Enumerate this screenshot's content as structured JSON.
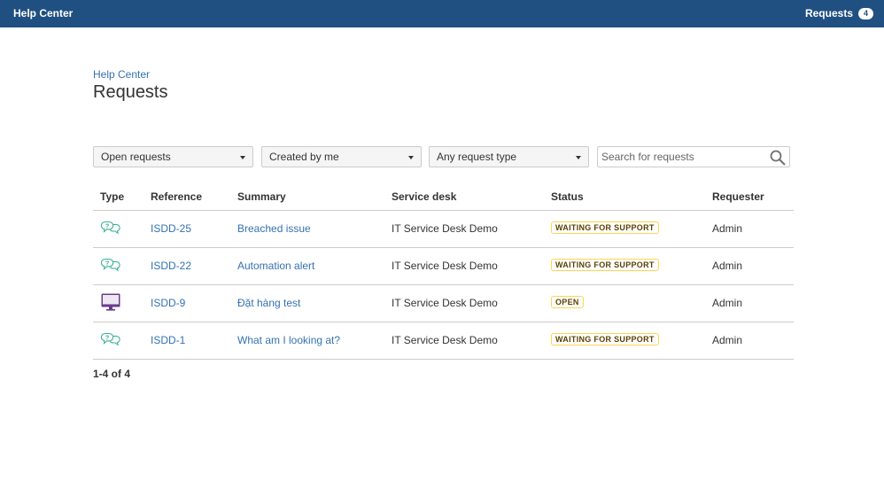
{
  "topbar": {
    "brand": "Help Center",
    "requests_label": "Requests",
    "requests_count": "4",
    "background": "#205081"
  },
  "breadcrumb": "Help Center",
  "page_title": "Requests",
  "filters": {
    "status": "Open requests",
    "creator": "Created by me",
    "request_type": "Any request type",
    "search_placeholder": "Search for requests"
  },
  "table": {
    "columns": [
      "Type",
      "Reference",
      "Summary",
      "Service desk",
      "Status",
      "Requester"
    ],
    "rows": [
      {
        "type_icon": "question-bubble-icon",
        "reference": "ISDD-25",
        "summary": "Breached issue",
        "service_desk": "IT Service Desk Demo",
        "status": "WAITING FOR SUPPORT",
        "requester": "Admin"
      },
      {
        "type_icon": "question-bubble-icon",
        "reference": "ISDD-22",
        "summary": "Automation alert",
        "service_desk": "IT Service Desk Demo",
        "status": "WAITING FOR SUPPORT",
        "requester": "Admin"
      },
      {
        "type_icon": "computer-monitor-icon",
        "reference": "ISDD-9",
        "summary": "Đặt hàng test",
        "service_desk": "IT Service Desk Demo",
        "status": "OPEN",
        "requester": "Admin"
      },
      {
        "type_icon": "question-bubble-icon",
        "reference": "ISDD-1",
        "summary": "What am I looking at?",
        "service_desk": "IT Service Desk Demo",
        "status": "WAITING FOR SUPPORT",
        "requester": "Admin"
      }
    ]
  },
  "pagination": "1-4 of 4",
  "colors": {
    "link": "#3572b0",
    "status_border": "#ffd351",
    "question_icon": "#3cb197",
    "monitor_icon": "#6a3b8c"
  }
}
